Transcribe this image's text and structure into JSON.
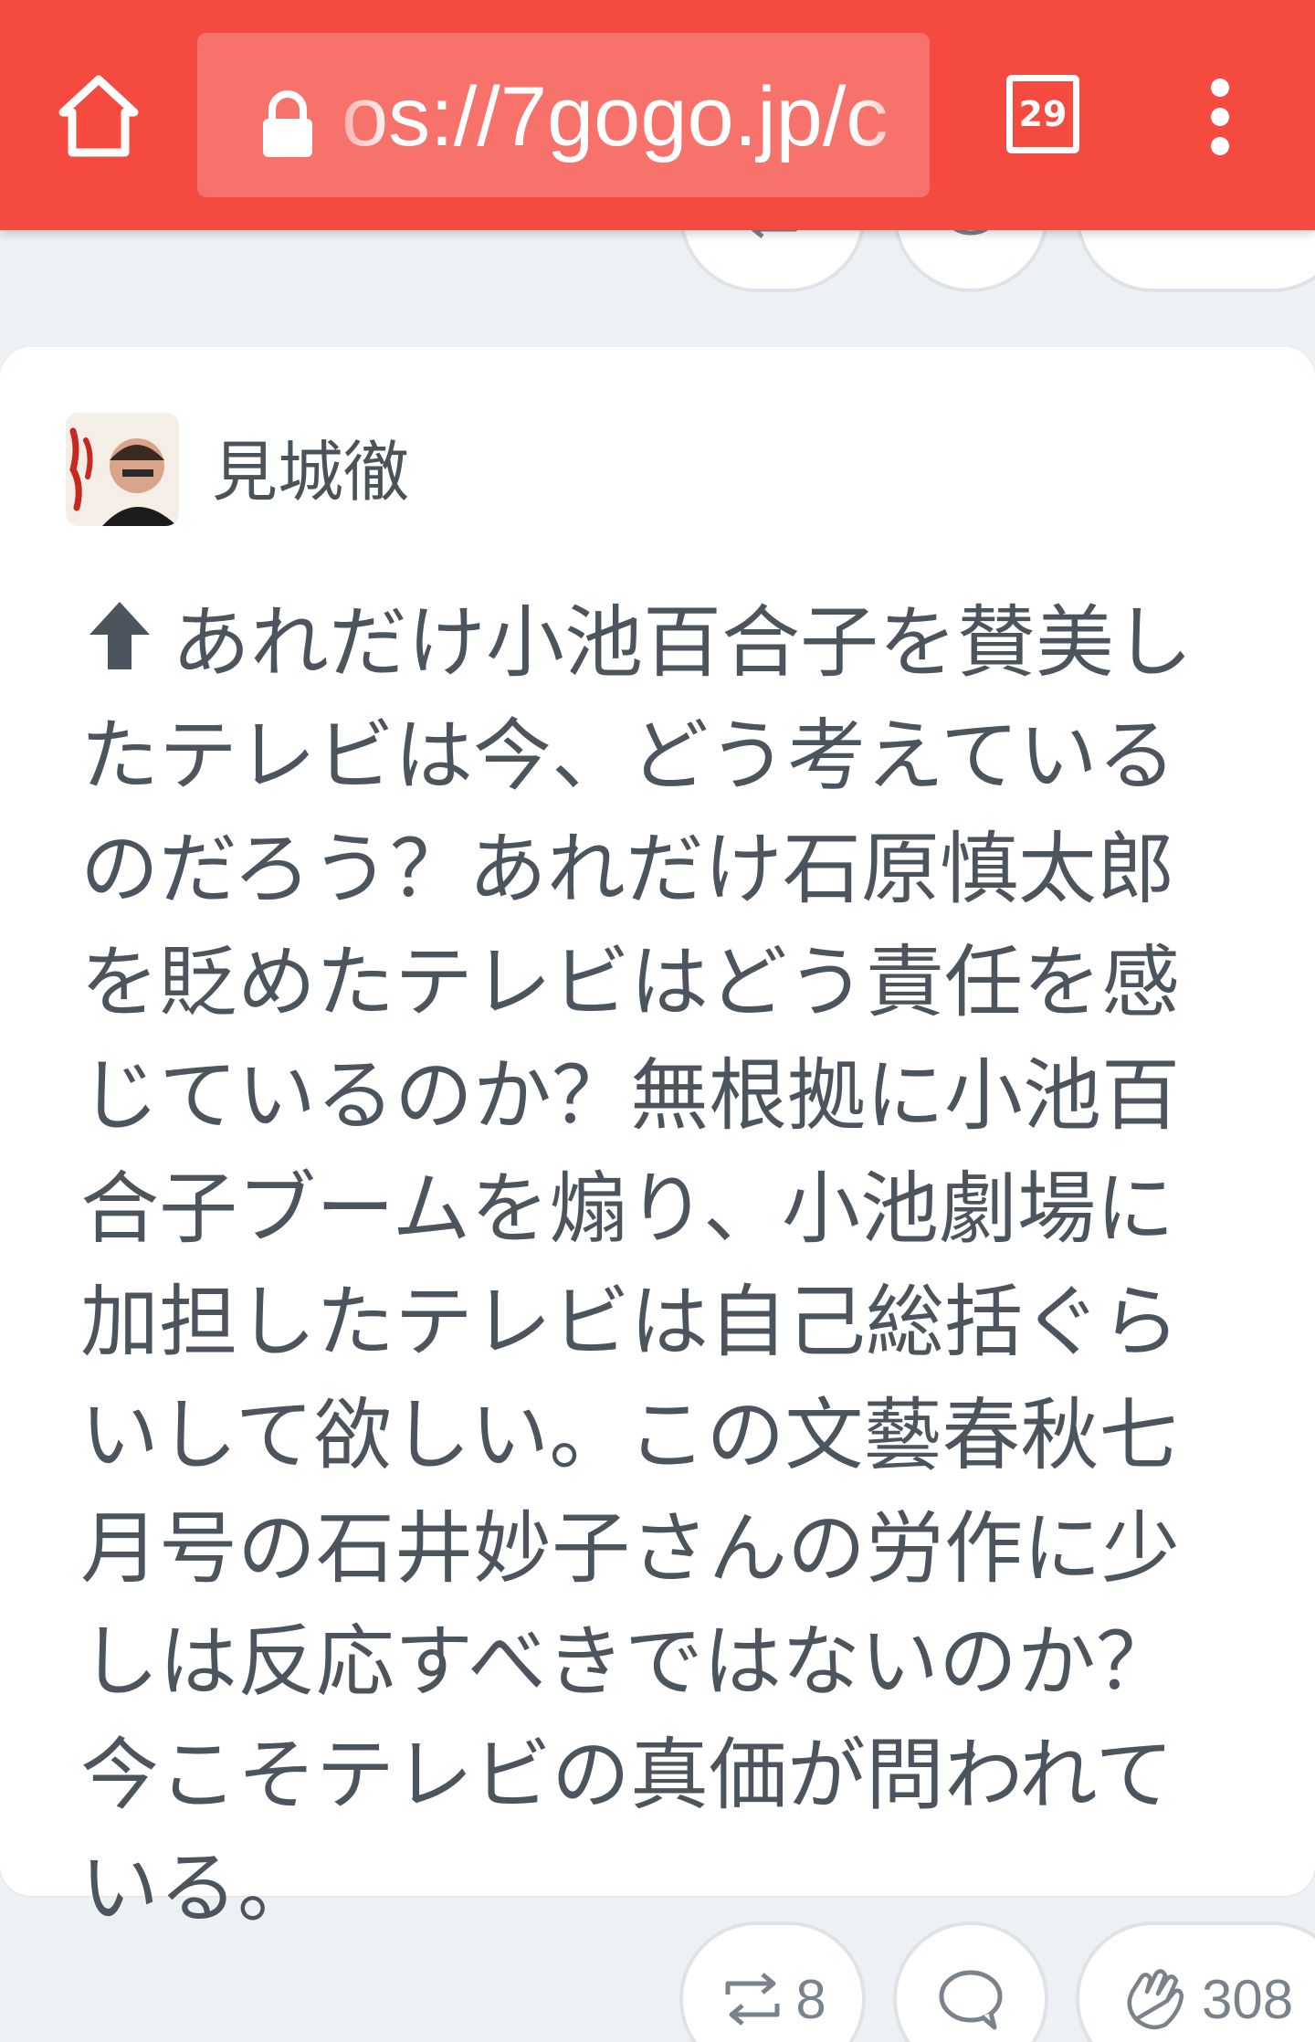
{
  "browser": {
    "url_text": "os://7gogo.jp/c",
    "tab_count": "29"
  },
  "post": {
    "author": "見城徹",
    "body": "あれだけ小池百合子を賛美したテレビは今、どう考えているのだろう？あれだけ石原慎太郎を貶めたテレビはどう責任を感じているのか？無根拠に小池百合子ブームを煽り、小池劇場に加担したテレビは自己総括ぐらいして欲しい。この文藝春秋七月号の石井妙子さんの労作に少しは反応すべきではないのか？今こそテレビの真価が問われている。"
  },
  "actions": {
    "repost_count": "8",
    "clap_count": "308"
  },
  "colors": {
    "toolbar": "#f44a3f",
    "url_bar": "#f7726a",
    "background": "#eef1f4",
    "text": "#4c555d"
  },
  "icons": [
    "home-icon",
    "lock-icon",
    "tabs-icon",
    "more-vert-icon",
    "up-arrow-icon",
    "repost-icon",
    "comment-icon",
    "clap-icon"
  ]
}
